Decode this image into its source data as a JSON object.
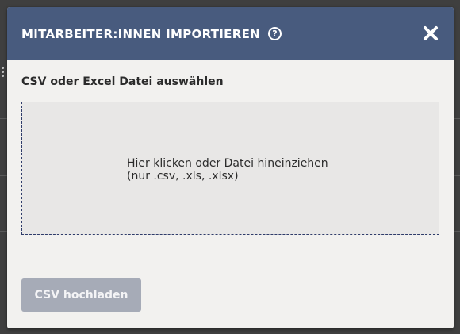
{
  "dialog": {
    "title": "MITARBEITER:INNEN IMPORTIEREN",
    "help_icon_glyph": "?",
    "close_icon": "close-icon",
    "colors": {
      "header_bg": "#485b7e",
      "body_bg": "#f2f1ef",
      "dropzone_bg": "#e8e7e6",
      "dropzone_border": "#2f3c6a",
      "button_bg": "#a6abb7"
    }
  },
  "file_select": {
    "label": "CSV oder Excel Datei auswählen",
    "dropzone_line1": "Hier klicken oder Datei hineinziehen",
    "dropzone_line2": "(nur .csv, .xls, .xlsx)"
  },
  "actions": {
    "upload_label": "CSV hochladen"
  }
}
